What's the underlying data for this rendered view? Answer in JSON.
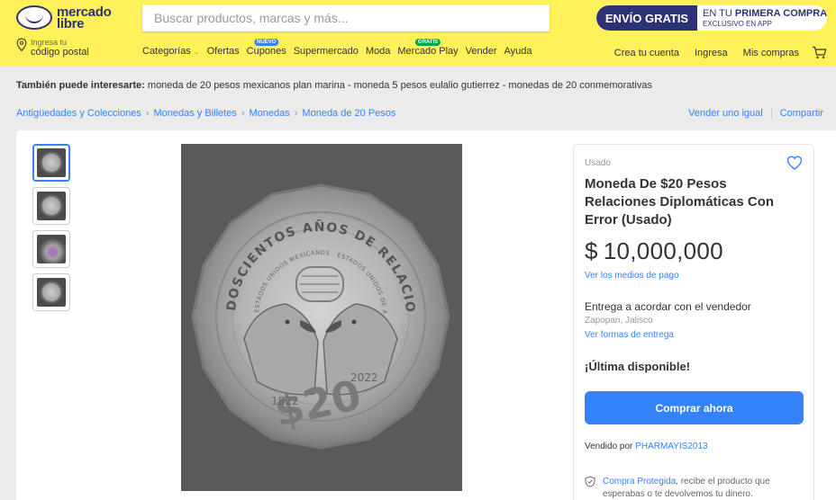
{
  "header": {
    "logo_line1": "mercado",
    "logo_line2": "libre",
    "search_placeholder": "Buscar productos, marcas y más...",
    "promo": {
      "left": "ENVÍO GRATIS",
      "line1_prefix": "EN TU",
      "line1_bold": "PRIMERA COMPRA",
      "line2": "EXCLUSIVO EN APP"
    },
    "location": {
      "small": "Ingresa tu",
      "big": "código postal"
    },
    "nav": [
      {
        "label": "Categorías",
        "badge": ""
      },
      {
        "label": "Ofertas",
        "badge": ""
      },
      {
        "label": "Cupones",
        "badge": "NUEVO"
      },
      {
        "label": "Supermercado",
        "badge": ""
      },
      {
        "label": "Moda",
        "badge": ""
      },
      {
        "label": "Mercado Play",
        "badge": "GRATIS"
      },
      {
        "label": "Vender",
        "badge": ""
      },
      {
        "label": "Ayuda",
        "badge": ""
      }
    ],
    "account": {
      "create": "Crea tu cuenta",
      "login": "Ingresa",
      "purchases": "Mis compras"
    }
  },
  "related": {
    "label": "También puede interesarte:",
    "items": "moneda de 20 pesos mexicanos plan marina - moneda 5 pesos eulalio gutierrez - monedas de 20 conmemorativas"
  },
  "breadcrumb": {
    "items": [
      "Antigüedades y Colecciones",
      "Monedas y Billetes",
      "Monedas",
      "Moneda de 20 Pesos"
    ],
    "sell_similar": "Vender uno igual",
    "share": "Compartir"
  },
  "product": {
    "condition": "Usado",
    "title": "Moneda De $20 Pesos Relaciones Diplomáticas Con Error (Usado)",
    "price_currency": "$",
    "price": "10,000,000",
    "payment_link": "Ver los medios de pago",
    "delivery": "Entrega a acordar con el vendedor",
    "location": "Zapopan, Jalisco",
    "shipping_link": "Ver formas de entrega",
    "stock": "¡Última disponible!",
    "buy_button": "Comprar ahora",
    "seller_prefix": "Vendido por",
    "seller_name": "PHARMAYIS2013",
    "protection_link": "Compra Protegida",
    "protection_text": ", recibe el producto que esperabas o te devolvemos tu dinero."
  },
  "coin": {
    "top_text": "DOSCIENTOS AÑOS DE RELACIONES DIPLOMÁTICAS",
    "inner_text": "ESTADOS UNIDOS MEXICANOS · ESTADOS UNIDOS DE AMÉRICA",
    "denomination": "$20",
    "year_left": "1822",
    "year_right": "2022"
  },
  "colors": {
    "header_bg": "#fff159",
    "brand_blue": "#2d3277",
    "accent": "#3483fa",
    "page_bg": "#ebebeb"
  },
  "icons": [
    "search-icon",
    "location-pin-icon",
    "cart-icon",
    "heart-icon",
    "shield-check-icon",
    "chevron-down-icon"
  ]
}
